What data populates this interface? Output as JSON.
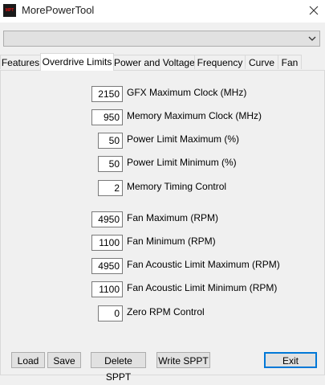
{
  "window": {
    "title": "MorePowerTool",
    "icon_text": "MPT"
  },
  "device_select": {
    "value": ""
  },
  "tabs": [
    {
      "label": "Features"
    },
    {
      "label": "Overdrive Limits",
      "active": true
    },
    {
      "label": "Power and Voltage"
    },
    {
      "label": "Frequency"
    },
    {
      "label": "Curve"
    },
    {
      "label": "Fan"
    }
  ],
  "fields": [
    {
      "value": "2150",
      "label": "GFX Maximum Clock (MHz)"
    },
    {
      "value": "950",
      "label": "Memory Maximum Clock (MHz)"
    },
    {
      "value": "50",
      "label": "Power Limit Maximum (%)"
    },
    {
      "value": "50",
      "label": "Power Limit Minimum (%)"
    },
    {
      "value": "2",
      "label": "Memory Timing Control"
    },
    {
      "value": "4950",
      "label": "Fan Maximum (RPM)"
    },
    {
      "value": "1100",
      "label": "Fan Minimum (RPM)"
    },
    {
      "value": "4950",
      "label": "Fan Acoustic Limit Maximum (RPM)"
    },
    {
      "value": "1100",
      "label": "Fan Acoustic Limit Minimum (RPM)"
    },
    {
      "value": "0",
      "label": "Zero RPM Control"
    }
  ],
  "buttons": {
    "load": "Load",
    "save": "Save",
    "delete_sppt": "Delete SPPT",
    "write_sppt": "Write SPPT",
    "exit": "Exit"
  },
  "colors": {
    "accent": "#0078d7",
    "window_bg": "#f0f0f0",
    "icon_red": "#e01010"
  }
}
